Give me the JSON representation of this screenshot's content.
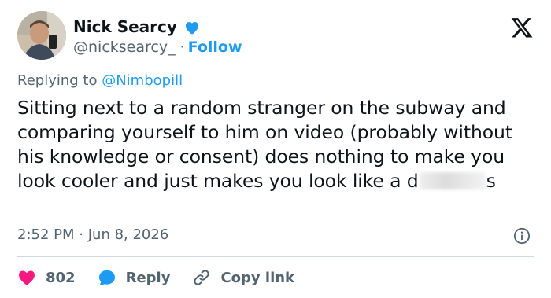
{
  "author": {
    "name": "Nick Searcy",
    "handle": "@nicksearcy_",
    "separator": "·",
    "follow_label": "Follow"
  },
  "reply_context": {
    "prefix": "Replying to",
    "mention": "@Nimbopill"
  },
  "tweet": {
    "text_before": "Sitting next to a random stranger on the subway and comparing yourself to him on video (probably without his knowledge or consent) does nothing to make you look cooler and just makes you look like a d",
    "text_after": "s",
    "time": "2:52 PM",
    "separator": "·",
    "date": "Jun 8, 2026"
  },
  "actions": {
    "like_count": "802",
    "reply_label": "Reply",
    "copy_label": "Copy link"
  },
  "colors": {
    "accent": "#1d9bf0",
    "like": "#f91880",
    "muted": "#536471",
    "text": "#0f1419"
  },
  "icons": [
    "verified-badge-icon",
    "x-logo-icon",
    "info-icon",
    "heart-icon",
    "reply-bubble-icon",
    "link-icon"
  ]
}
